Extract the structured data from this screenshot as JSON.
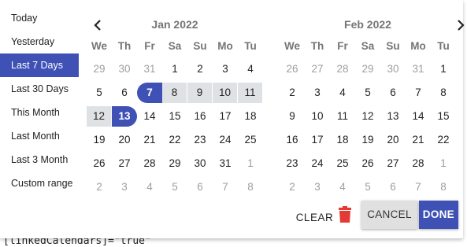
{
  "background_code": "[linkedCalendars]=\"true\"",
  "ranges": [
    {
      "label": "Today",
      "active": false
    },
    {
      "label": "Yesterday",
      "active": false
    },
    {
      "label": "Last 7 Days",
      "active": true
    },
    {
      "label": "Last 30 Days",
      "active": false
    },
    {
      "label": "This Month",
      "active": false
    },
    {
      "label": "Last Month",
      "active": false
    },
    {
      "label": "Last 3 Month",
      "active": false
    },
    {
      "label": "Custom range",
      "active": false
    }
  ],
  "weekdays": [
    "We",
    "Th",
    "Fr",
    "Sa",
    "Su",
    "Mo",
    "Tu"
  ],
  "calendars": [
    {
      "title": "Jan 2022",
      "weeks": [
        [
          [
            "29",
            "off",
            ""
          ],
          [
            "30",
            "off",
            ""
          ],
          [
            "31",
            "off",
            ""
          ],
          [
            "1",
            "",
            ""
          ],
          [
            "2",
            "",
            ""
          ],
          [
            "3",
            "",
            ""
          ],
          [
            "4",
            "",
            ""
          ]
        ],
        [
          [
            "5",
            "",
            ""
          ],
          [
            "6",
            "",
            ""
          ],
          [
            "7",
            "",
            "start"
          ],
          [
            "8",
            "",
            "in"
          ],
          [
            "9",
            "",
            "in"
          ],
          [
            "10",
            "",
            "in"
          ],
          [
            "11",
            "",
            "in"
          ]
        ],
        [
          [
            "12",
            "",
            "in"
          ],
          [
            "13",
            "",
            "end"
          ],
          [
            "14",
            "",
            ""
          ],
          [
            "15",
            "",
            ""
          ],
          [
            "16",
            "",
            ""
          ],
          [
            "17",
            "",
            ""
          ],
          [
            "18",
            "",
            ""
          ]
        ],
        [
          [
            "19",
            "",
            ""
          ],
          [
            "20",
            "",
            ""
          ],
          [
            "21",
            "",
            ""
          ],
          [
            "22",
            "",
            ""
          ],
          [
            "23",
            "",
            ""
          ],
          [
            "24",
            "",
            ""
          ],
          [
            "25",
            "",
            ""
          ]
        ],
        [
          [
            "26",
            "",
            ""
          ],
          [
            "27",
            "",
            ""
          ],
          [
            "28",
            "",
            ""
          ],
          [
            "29",
            "",
            ""
          ],
          [
            "30",
            "",
            ""
          ],
          [
            "31",
            "",
            ""
          ],
          [
            "1",
            "off",
            ""
          ]
        ],
        [
          [
            "2",
            "off",
            ""
          ],
          [
            "3",
            "off",
            ""
          ],
          [
            "4",
            "off",
            ""
          ],
          [
            "5",
            "off",
            ""
          ],
          [
            "6",
            "off",
            ""
          ],
          [
            "7",
            "off",
            ""
          ],
          [
            "8",
            "off",
            ""
          ]
        ]
      ]
    },
    {
      "title": "Feb 2022",
      "weeks": [
        [
          [
            "26",
            "off",
            ""
          ],
          [
            "27",
            "off",
            ""
          ],
          [
            "28",
            "off",
            ""
          ],
          [
            "29",
            "off",
            ""
          ],
          [
            "30",
            "off",
            ""
          ],
          [
            "31",
            "off",
            ""
          ],
          [
            "1",
            "",
            ""
          ]
        ],
        [
          [
            "2",
            "",
            ""
          ],
          [
            "3",
            "",
            ""
          ],
          [
            "4",
            "",
            ""
          ],
          [
            "5",
            "",
            ""
          ],
          [
            "6",
            "",
            ""
          ],
          [
            "7",
            "",
            ""
          ],
          [
            "8",
            "",
            ""
          ]
        ],
        [
          [
            "9",
            "",
            ""
          ],
          [
            "10",
            "",
            ""
          ],
          [
            "11",
            "",
            ""
          ],
          [
            "12",
            "",
            ""
          ],
          [
            "13",
            "",
            ""
          ],
          [
            "14",
            "",
            ""
          ],
          [
            "15",
            "",
            ""
          ]
        ],
        [
          [
            "16",
            "",
            ""
          ],
          [
            "17",
            "",
            ""
          ],
          [
            "18",
            "",
            ""
          ],
          [
            "19",
            "",
            ""
          ],
          [
            "20",
            "",
            ""
          ],
          [
            "21",
            "",
            ""
          ],
          [
            "22",
            "",
            ""
          ]
        ],
        [
          [
            "23",
            "",
            ""
          ],
          [
            "24",
            "",
            ""
          ],
          [
            "25",
            "",
            ""
          ],
          [
            "26",
            "",
            ""
          ],
          [
            "27",
            "",
            ""
          ],
          [
            "28",
            "",
            ""
          ],
          [
            "1",
            "off",
            ""
          ]
        ],
        [
          [
            "2",
            "off",
            ""
          ],
          [
            "3",
            "off",
            ""
          ],
          [
            "4",
            "off",
            ""
          ],
          [
            "5",
            "off",
            ""
          ],
          [
            "6",
            "off",
            ""
          ],
          [
            "7",
            "off",
            ""
          ],
          [
            "8",
            "off",
            ""
          ]
        ]
      ]
    }
  ],
  "nav": {
    "prev_icon": "chevron-left-icon",
    "next_icon": "chevron-right-icon"
  },
  "actions": {
    "clear_label": "CLEAR",
    "trash_icon": "trash-icon",
    "cancel_label": "CANCEL",
    "done_label": "DONE"
  },
  "colors": {
    "accent": "#3f51b5",
    "range_bg": "#dfe2e4",
    "trash": "#e53935"
  }
}
